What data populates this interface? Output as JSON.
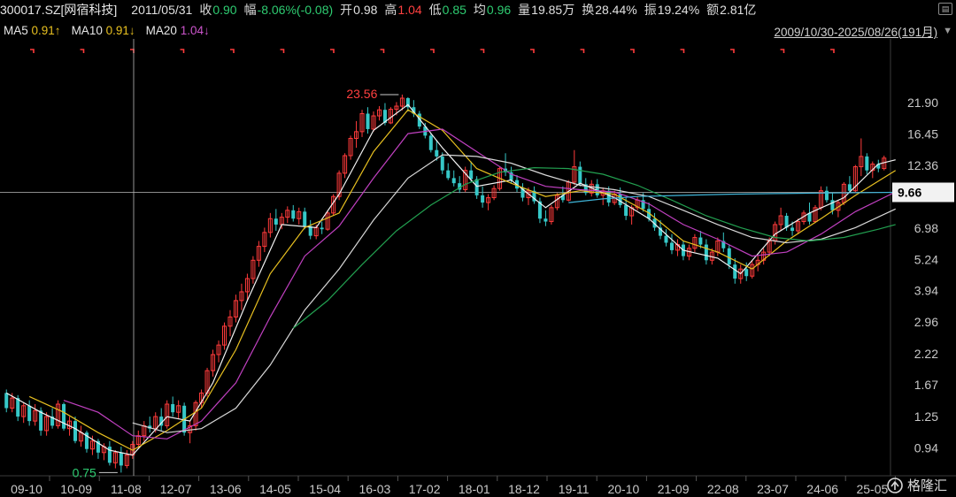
{
  "header": {
    "code_name": "300017.SZ[网宿科技]",
    "date": "2011/05/31",
    "close_label": "收",
    "close_value": "0.90",
    "change_label": "幅",
    "change_value": "-8.06%(-0.08)",
    "open_label": "开",
    "open_value": "0.98",
    "high_label": "高",
    "high_value": "1.04",
    "low_label": "低",
    "low_value": "0.85",
    "avg_label": "均",
    "avg_value": "0.96",
    "volume_label": "量",
    "volume_value": "19.85万",
    "turnover_label": "换",
    "turnover_value": "28.44%",
    "amplitude_label": "振",
    "amplitude_value": "19.24%",
    "amount_label": "额",
    "amount_value": "2.81亿"
  },
  "ma_bar": {
    "ma5_label": "MA5",
    "ma5_value": "0.91↑",
    "ma10_label": "MA10",
    "ma10_value": "0.91↓",
    "ma20_label": "MA20",
    "ma20_value": "1.04↓",
    "range_text": "2009/10/30-2025/08/26(191月)",
    "range_caret": "▼"
  },
  "colors": {
    "up": "#ff3b3b",
    "down": "#36c8c8",
    "ma5": "#f2f2f2",
    "ma10": "#e8c020",
    "ma20": "#c040c0",
    "ma_long1": "#d8d8d8",
    "ma_long2": "#22a050",
    "ma_long3": "#3fb4d8",
    "grid": "#2a2a2a",
    "axis_text": "#c8c8c8"
  },
  "watermark": {
    "text": "格隆汇"
  },
  "chart_data": {
    "type": "candlestick",
    "scale": "log",
    "y_ticks": [
      "21.90",
      "16.45",
      "12.36",
      "9.66",
      "6.98",
      "5.24",
      "3.94",
      "2.96",
      "2.22",
      "1.67",
      "1.25",
      "0.94"
    ],
    "x_ticks": [
      "09-10",
      "10-09",
      "11-08",
      "12-07",
      "13-06",
      "14-05",
      "15-04",
      "16-03",
      "17-02",
      "18-01",
      "18-12",
      "19-11",
      "20-10",
      "21-09",
      "22-08",
      "23-07",
      "24-06",
      "25-05"
    ],
    "current_price": "9.66",
    "annotations": {
      "high": "23.56",
      "low": "0.75"
    },
    "ohlc": [
      [
        1.55,
        1.6,
        1.3,
        1.35
      ],
      [
        1.35,
        1.55,
        1.3,
        1.48
      ],
      [
        1.48,
        1.52,
        1.2,
        1.25
      ],
      [
        1.25,
        1.42,
        1.18,
        1.38
      ],
      [
        1.38,
        1.45,
        1.15,
        1.2
      ],
      [
        1.2,
        1.4,
        1.15,
        1.32
      ],
      [
        1.32,
        1.36,
        1.05,
        1.1
      ],
      [
        1.1,
        1.3,
        1.05,
        1.25
      ],
      [
        1.25,
        1.35,
        1.12,
        1.15
      ],
      [
        1.15,
        1.45,
        1.12,
        1.4
      ],
      [
        1.4,
        1.42,
        1.1,
        1.12
      ],
      [
        1.12,
        1.25,
        1.05,
        1.2
      ],
      [
        1.2,
        1.25,
        0.98,
        1.0
      ],
      [
        1.0,
        1.15,
        0.95,
        1.08
      ],
      [
        1.08,
        1.1,
        0.9,
        0.93
      ],
      [
        0.93,
        1.05,
        0.88,
        1.0
      ],
      [
        1.0,
        1.02,
        0.85,
        0.9
      ],
      [
        0.9,
        0.98,
        0.84,
        0.95
      ],
      [
        0.95,
        1.0,
        0.8,
        0.82
      ],
      [
        0.82,
        0.92,
        0.78,
        0.9
      ],
      [
        0.9,
        0.95,
        0.75,
        0.8
      ],
      [
        0.8,
        0.92,
        0.78,
        0.88
      ],
      [
        0.88,
        1.0,
        0.85,
        0.97
      ],
      [
        0.97,
        1.1,
        0.94,
        1.05
      ],
      [
        1.05,
        1.2,
        1.0,
        1.15
      ],
      [
        1.15,
        1.25,
        1.08,
        1.12
      ],
      [
        1.12,
        1.3,
        1.08,
        1.25
      ],
      [
        1.25,
        1.35,
        1.1,
        1.15
      ],
      [
        1.15,
        1.45,
        1.12,
        1.4
      ],
      [
        1.4,
        1.5,
        1.25,
        1.3
      ],
      [
        1.3,
        1.45,
        1.22,
        1.38
      ],
      [
        1.38,
        1.42,
        1.05,
        1.08
      ],
      [
        1.08,
        1.2,
        0.98,
        1.15
      ],
      [
        1.15,
        1.45,
        1.1,
        1.42
      ],
      [
        1.42,
        1.6,
        1.35,
        1.55
      ],
      [
        1.55,
        1.95,
        1.5,
        1.9
      ],
      [
        1.9,
        2.3,
        1.8,
        2.2
      ],
      [
        2.2,
        2.5,
        2.05,
        2.4
      ],
      [
        2.4,
        2.95,
        2.3,
        2.85
      ],
      [
        2.85,
        3.3,
        2.6,
        3.1
      ],
      [
        3.1,
        3.8,
        2.95,
        3.6
      ],
      [
        3.6,
        4.2,
        3.3,
        3.9
      ],
      [
        3.9,
        4.6,
        3.6,
        4.4
      ],
      [
        4.4,
        5.4,
        4.2,
        5.2
      ],
      [
        5.2,
        6.2,
        4.9,
        5.9
      ],
      [
        5.9,
        7.0,
        5.6,
        6.7
      ],
      [
        6.7,
        8.0,
        6.4,
        7.6
      ],
      [
        7.6,
        8.3,
        6.8,
        7.2
      ],
      [
        7.2,
        8.0,
        6.9,
        7.7
      ],
      [
        7.7,
        8.5,
        7.3,
        8.2
      ],
      [
        8.2,
        8.6,
        7.4,
        7.6
      ],
      [
        7.6,
        8.4,
        7.2,
        8.1
      ],
      [
        8.1,
        8.4,
        6.9,
        7.1
      ],
      [
        7.1,
        7.5,
        6.3,
        6.5
      ],
      [
        6.5,
        7.2,
        6.3,
        7.0
      ],
      [
        7.0,
        7.4,
        6.6,
        6.9
      ],
      [
        6.9,
        8.2,
        6.8,
        8.0
      ],
      [
        8.0,
        9.5,
        7.8,
        9.3
      ],
      [
        9.3,
        11.8,
        9.0,
        11.5
      ],
      [
        11.5,
        13.8,
        11.0,
        13.5
      ],
      [
        13.5,
        16.2,
        13.0,
        15.8
      ],
      [
        15.8,
        18.5,
        14.5,
        16.8
      ],
      [
        16.8,
        20.5,
        16.0,
        19.8
      ],
      [
        19.8,
        21.0,
        16.5,
        17.2
      ],
      [
        17.2,
        20.2,
        16.8,
        19.4
      ],
      [
        19.4,
        21.2,
        18.6,
        20.5
      ],
      [
        20.5,
        21.8,
        17.8,
        18.2
      ],
      [
        18.2,
        21.0,
        18.0,
        20.6
      ],
      [
        20.6,
        22.0,
        19.5,
        21.2
      ],
      [
        21.2,
        23.56,
        20.4,
        22.8
      ],
      [
        22.8,
        23.0,
        20.2,
        21.0
      ],
      [
        21.0,
        22.4,
        19.2,
        19.8
      ],
      [
        19.8,
        20.3,
        17.2,
        17.6
      ],
      [
        17.6,
        18.2,
        15.8,
        16.2
      ],
      [
        16.2,
        16.6,
        13.9,
        14.2
      ],
      [
        14.2,
        15.6,
        12.9,
        13.4
      ],
      [
        13.4,
        13.9,
        11.4,
        11.8
      ],
      [
        11.8,
        12.6,
        10.8,
        11.0
      ],
      [
        11.0,
        11.8,
        10.2,
        10.5
      ],
      [
        10.5,
        11.2,
        9.6,
        9.9
      ],
      [
        9.9,
        12.2,
        9.7,
        11.8
      ],
      [
        11.8,
        12.8,
        10.6,
        10.9
      ],
      [
        10.9,
        11.2,
        9.1,
        9.4
      ],
      [
        9.4,
        10.2,
        8.4,
        8.8
      ],
      [
        8.8,
        9.5,
        8.2,
        9.2
      ],
      [
        9.2,
        10.3,
        9.0,
        10.0
      ],
      [
        10.0,
        12.2,
        9.8,
        12.0
      ],
      [
        12.0,
        13.8,
        11.2,
        11.6
      ],
      [
        11.6,
        12.2,
        10.5,
        10.8
      ],
      [
        10.8,
        11.3,
        9.7,
        10.0
      ],
      [
        10.0,
        10.5,
        8.9,
        9.2
      ],
      [
        9.2,
        10.1,
        8.6,
        9.8
      ],
      [
        9.8,
        10.2,
        8.7,
        8.9
      ],
      [
        8.9,
        9.2,
        7.3,
        7.6
      ],
      [
        7.6,
        8.2,
        7.1,
        7.4
      ],
      [
        7.4,
        8.6,
        7.2,
        8.4
      ],
      [
        8.4,
        9.6,
        8.2,
        9.4
      ],
      [
        9.4,
        10.2,
        8.8,
        9.0
      ],
      [
        9.0,
        10.8,
        8.9,
        10.6
      ],
      [
        10.6,
        14.2,
        10.3,
        12.2
      ],
      [
        12.2,
        12.8,
        10.2,
        10.4
      ],
      [
        10.4,
        11.0,
        9.4,
        9.6
      ],
      [
        9.6,
        10.8,
        9.3,
        10.4
      ],
      [
        10.4,
        10.9,
        9.2,
        9.4
      ],
      [
        9.4,
        10.1,
        8.6,
        9.8
      ],
      [
        9.8,
        10.2,
        8.5,
        8.8
      ],
      [
        8.8,
        9.8,
        8.6,
        9.5
      ],
      [
        9.5,
        10.1,
        8.4,
        8.6
      ],
      [
        8.6,
        9.2,
        7.5,
        7.8
      ],
      [
        7.8,
        8.6,
        7.2,
        8.4
      ],
      [
        8.4,
        9.3,
        8.2,
        9.0
      ],
      [
        9.0,
        9.6,
        8.1,
        8.3
      ],
      [
        8.3,
        8.8,
        7.4,
        7.6
      ],
      [
        7.6,
        8.0,
        6.8,
        7.0
      ],
      [
        7.0,
        7.5,
        6.3,
        6.5
      ],
      [
        6.5,
        6.9,
        5.9,
        6.1
      ],
      [
        6.1,
        6.6,
        5.5,
        5.7
      ],
      [
        5.7,
        6.3,
        5.4,
        6.0
      ],
      [
        6.0,
        6.2,
        5.2,
        5.4
      ],
      [
        5.4,
        6.0,
        5.2,
        5.8
      ],
      [
        5.8,
        6.6,
        5.6,
        6.4
      ],
      [
        6.4,
        6.8,
        5.8,
        6.0
      ],
      [
        6.0,
        6.3,
        5.0,
        5.2
      ],
      [
        5.2,
        5.8,
        5.0,
        5.6
      ],
      [
        5.6,
        6.4,
        5.4,
        6.2
      ],
      [
        6.2,
        6.7,
        5.6,
        5.8
      ],
      [
        5.8,
        6.0,
        4.8,
        5.0
      ],
      [
        5.0,
        5.3,
        4.2,
        4.4
      ],
      [
        4.4,
        5.0,
        4.2,
        4.8
      ],
      [
        4.8,
        5.1,
        4.3,
        4.5
      ],
      [
        4.5,
        5.2,
        4.4,
        5.0
      ],
      [
        5.0,
        5.4,
        4.7,
        5.2
      ],
      [
        5.2,
        5.8,
        5.0,
        5.6
      ],
      [
        5.6,
        6.4,
        5.4,
        6.2
      ],
      [
        6.2,
        7.4,
        6.0,
        7.2
      ],
      [
        7.2,
        8.4,
        6.8,
        7.8
      ],
      [
        7.8,
        8.0,
        6.8,
        7.0
      ],
      [
        7.0,
        7.4,
        6.5,
        6.8
      ],
      [
        6.8,
        7.6,
        6.6,
        7.4
      ],
      [
        7.4,
        8.2,
        7.2,
        8.0
      ],
      [
        8.0,
        8.8,
        7.2,
        7.4
      ],
      [
        7.4,
        8.6,
        7.3,
        8.4
      ],
      [
        8.4,
        10.2,
        8.2,
        9.8
      ],
      [
        9.8,
        10.2,
        8.8,
        9.0
      ],
      [
        9.0,
        9.6,
        7.9,
        8.2
      ],
      [
        8.2,
        9.0,
        7.7,
        8.8
      ],
      [
        8.8,
        10.6,
        8.6,
        10.4
      ],
      [
        10.4,
        11.2,
        9.6,
        9.8
      ],
      [
        9.8,
        12.4,
        9.6,
        12.2
      ],
      [
        12.2,
        15.8,
        11.2,
        13.4
      ],
      [
        13.4,
        13.8,
        11.4,
        11.8
      ],
      [
        11.8,
        12.8,
        11.0,
        12.5
      ],
      [
        12.5,
        13.0,
        11.6,
        12.0
      ],
      [
        12.0,
        13.5,
        11.8,
        13.2
      ]
    ],
    "ma_lines": {
      "ma5": [
        [
          0,
          1.55
        ],
        [
          6,
          1.3
        ],
        [
          12,
          1.12
        ],
        [
          18,
          0.92
        ],
        [
          22,
          0.88
        ],
        [
          28,
          1.25
        ],
        [
          32,
          1.2
        ],
        [
          36,
          1.7
        ],
        [
          42,
          3.6
        ],
        [
          48,
          7.2
        ],
        [
          54,
          7.0
        ],
        [
          58,
          9.5
        ],
        [
          64,
          17.0
        ],
        [
          70,
          21.5
        ],
        [
          76,
          14.5
        ],
        [
          82,
          10.2
        ],
        [
          88,
          10.8
        ],
        [
          94,
          8.4
        ],
        [
          100,
          10.5
        ],
        [
          106,
          9.2
        ],
        [
          112,
          7.6
        ],
        [
          118,
          5.7
        ],
        [
          124,
          5.3
        ],
        [
          128,
          4.6
        ],
        [
          134,
          6.6
        ],
        [
          140,
          8.0
        ],
        [
          146,
          9.2
        ],
        [
          152,
          12.5
        ],
        [
          155,
          13.0
        ]
      ],
      "ma10": [
        [
          4,
          1.5
        ],
        [
          10,
          1.3
        ],
        [
          16,
          1.08
        ],
        [
          22,
          0.92
        ],
        [
          28,
          1.1
        ],
        [
          34,
          1.35
        ],
        [
          40,
          2.3
        ],
        [
          46,
          4.6
        ],
        [
          52,
          7.0
        ],
        [
          58,
          8.0
        ],
        [
          64,
          14.0
        ],
        [
          70,
          20.5
        ],
        [
          76,
          17.0
        ],
        [
          82,
          12.0
        ],
        [
          88,
          10.5
        ],
        [
          94,
          9.3
        ],
        [
          100,
          9.8
        ],
        [
          106,
          9.5
        ],
        [
          112,
          8.0
        ],
        [
          118,
          6.2
        ],
        [
          124,
          5.6
        ],
        [
          130,
          4.8
        ],
        [
          136,
          6.2
        ],
        [
          142,
          7.6
        ],
        [
          148,
          9.4
        ],
        [
          155,
          11.8
        ]
      ],
      "ma20": [
        [
          10,
          1.45
        ],
        [
          16,
          1.3
        ],
        [
          22,
          1.05
        ],
        [
          28,
          1.02
        ],
        [
          34,
          1.2
        ],
        [
          40,
          1.7
        ],
        [
          46,
          3.1
        ],
        [
          52,
          5.4
        ],
        [
          58,
          7.1
        ],
        [
          64,
          11.0
        ],
        [
          70,
          16.5
        ],
        [
          76,
          17.2
        ],
        [
          82,
          14.0
        ],
        [
          88,
          11.4
        ],
        [
          94,
          10.2
        ],
        [
          100,
          9.9
        ],
        [
          106,
          9.7
        ],
        [
          112,
          8.7
        ],
        [
          118,
          7.2
        ],
        [
          124,
          6.3
        ],
        [
          130,
          5.4
        ],
        [
          136,
          5.6
        ],
        [
          142,
          6.6
        ],
        [
          148,
          8.1
        ],
        [
          155,
          9.7
        ]
      ],
      "ma_long1": [
        [
          22,
          1.18
        ],
        [
          28,
          1.08
        ],
        [
          34,
          1.12
        ],
        [
          40,
          1.35
        ],
        [
          46,
          2.0
        ],
        [
          52,
          3.3
        ],
        [
          58,
          4.8
        ],
        [
          64,
          7.5
        ],
        [
          70,
          11.0
        ],
        [
          76,
          13.6
        ],
        [
          82,
          13.4
        ],
        [
          88,
          12.6
        ],
        [
          94,
          11.3
        ],
        [
          100,
          10.3
        ],
        [
          106,
          9.9
        ],
        [
          112,
          9.3
        ],
        [
          118,
          8.2
        ],
        [
          124,
          7.2
        ],
        [
          130,
          6.4
        ],
        [
          136,
          6.1
        ],
        [
          142,
          6.3
        ],
        [
          148,
          7.0
        ],
        [
          155,
          8.3
        ]
      ],
      "ma_long2": [
        [
          50,
          2.8
        ],
        [
          56,
          3.6
        ],
        [
          62,
          5.0
        ],
        [
          68,
          6.8
        ],
        [
          74,
          8.6
        ],
        [
          80,
          10.4
        ],
        [
          86,
          11.6
        ],
        [
          92,
          12.1
        ],
        [
          98,
          12.0
        ],
        [
          104,
          11.4
        ],
        [
          110,
          10.3
        ],
        [
          116,
          9.0
        ],
        [
          122,
          7.8
        ],
        [
          128,
          7.0
        ],
        [
          134,
          6.4
        ],
        [
          140,
          6.2
        ],
        [
          146,
          6.4
        ],
        [
          152,
          6.9
        ],
        [
          155,
          7.2
        ]
      ],
      "ma_long3": [
        [
          98,
          8.8
        ],
        [
          104,
          9.1
        ],
        [
          110,
          9.3
        ],
        [
          118,
          9.4
        ],
        [
          126,
          9.5
        ],
        [
          134,
          9.55
        ],
        [
          142,
          9.6
        ],
        [
          150,
          9.64
        ],
        [
          155,
          9.66
        ]
      ]
    }
  }
}
